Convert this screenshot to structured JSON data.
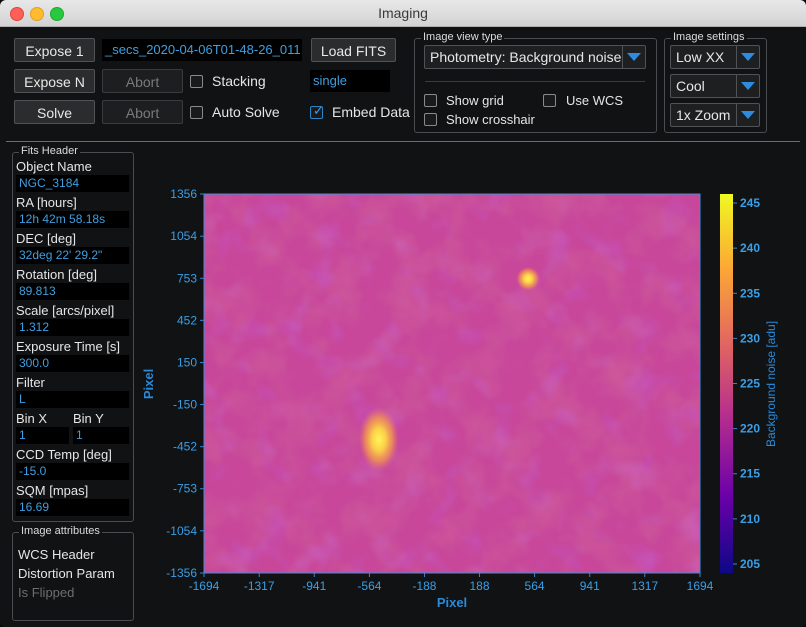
{
  "window": {
    "title": "Imaging"
  },
  "toolbar": {
    "expose1": "Expose 1",
    "exposeN": "Expose N",
    "solve": "Solve",
    "filename": "_secs_2020-04-06T01-48-26_011",
    "abort1": "Abort",
    "abort2": "Abort",
    "stacking": "Stacking",
    "auto_solve": "Auto Solve",
    "load_fits": "Load FITS",
    "single": "single",
    "embed_data": "Embed Data",
    "embed_checked": true
  },
  "view_group": {
    "title": "Image view type",
    "view_type": "Photometry: Background noise",
    "show_grid": "Show grid",
    "use_wcs": "Use WCS",
    "show_crosshair": "Show crosshair"
  },
  "settings_group": {
    "title": "Image settings",
    "stretch": "Low XX",
    "colormap": "Cool",
    "zoom": "1x Zoom"
  },
  "fits_header": {
    "title": "Fits Header",
    "object_name_label": "Object Name",
    "object_name": "NGC_3184",
    "ra_label": "RA [hours]",
    "ra": "12h 42m 58.18s",
    "dec_label": "DEC [deg]",
    "dec": "32deg 22' 29.2\"",
    "rotation_label": "Rotation [deg]",
    "rotation": "89.813",
    "scale_label": "Scale [arcs/pixel]",
    "scale": "1.312",
    "exposure_label": "Exposure Time [s]",
    "exposure": "300.0",
    "filter_label": "Filter",
    "filter": "L",
    "binx_label": "Bin X",
    "binx": "1",
    "biny_label": "Bin Y",
    "biny": "1",
    "ccd_temp_label": "CCD Temp [deg]",
    "ccd_temp": "-15.0",
    "sqm_label": "SQM [mpas]",
    "sqm": "16.69"
  },
  "image_attributes": {
    "title": "Image attributes",
    "wcs_header": "WCS Header",
    "distortion": "Distortion Param",
    "flipped": "Is Flipped"
  },
  "chart_data": {
    "type": "heatmap",
    "xlabel": "Pixel",
    "ylabel": "Pixel",
    "colorbar_label": "Background noise [adu]",
    "xlim": [
      -1694,
      1694
    ],
    "ylim": [
      -1356,
      1356
    ],
    "x_ticks": [
      "-1694",
      "-1317",
      "-941",
      "-564",
      "-188",
      "188",
      "564",
      "941",
      "1317",
      "1694"
    ],
    "y_ticks": [
      "1356",
      "1054",
      "753",
      "452",
      "150",
      "-150",
      "-452",
      "-753",
      "-1054",
      "-1356"
    ],
    "colorbar_range": [
      204,
      246
    ],
    "colorbar_ticks": [
      205,
      210,
      215,
      220,
      225,
      230,
      235,
      240,
      245
    ],
    "base_level": 216,
    "hotspots": [
      {
        "x": -500,
        "y": -400,
        "value": 243
      },
      {
        "x": 520,
        "y": 750,
        "value": 232
      }
    ],
    "colors": {
      "axis": "#2a8ad8",
      "frame": "#3b8fd8",
      "tick_text": "#3a9fe6"
    }
  }
}
